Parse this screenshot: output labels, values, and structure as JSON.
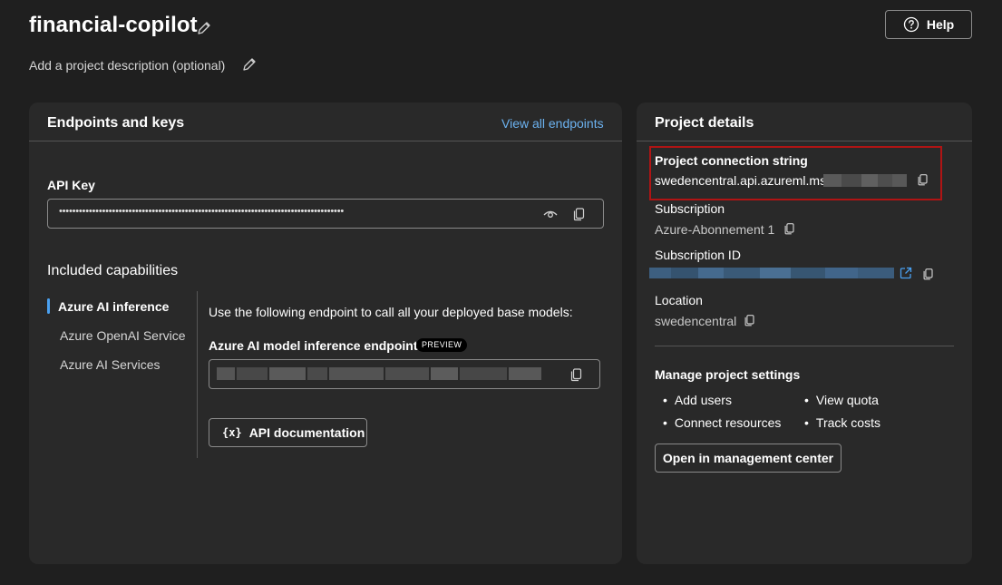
{
  "header": {
    "title": "financial-copilot",
    "description_placeholder": "Add a project description (optional)",
    "help_label": "Help"
  },
  "endpoints_card": {
    "title": "Endpoints and keys",
    "view_all_label": "View all endpoints",
    "api_key_label": "API Key",
    "api_key_value": "••••••••••••••••••••••••••••••••••••••••••••••••••••••••••••••••••••••••••••••••••••••",
    "capabilities_title": "Included capabilities",
    "capabilities": [
      {
        "label": "Azure AI inference",
        "selected": true
      },
      {
        "label": "Azure OpenAI Service",
        "selected": false
      },
      {
        "label": "Azure AI Services",
        "selected": false
      }
    ],
    "capability_description": "Use the following endpoint to call all your deployed base models:",
    "endpoint_label": "Azure AI model inference endpoint",
    "endpoint_badge": "PREVIEW",
    "api_doc_icon": "{x}",
    "api_doc_label": "API documentation"
  },
  "project_details": {
    "title": "Project details",
    "connection_string_label": "Project connection string",
    "connection_string_value": "swedencentral.api.azureml.ms;",
    "subscription_label": "Subscription",
    "subscription_value": "Azure-Abonnement 1",
    "subscription_id_label": "Subscription ID",
    "location_label": "Location",
    "location_value": "swedencentral",
    "manage_title": "Manage project settings",
    "manage_links": [
      "Add users",
      "View quota",
      "Connect resources",
      "Track costs"
    ],
    "open_management_label": "Open in management center"
  },
  "colors": {
    "background": "#1f1f1f",
    "card": "#292929",
    "link": "#6cb2f0",
    "selection_accent": "#4aa0f0",
    "highlight_box": "#b01414",
    "subscription_id_blur": "#3d5f80"
  },
  "icons": [
    "pencil-icon",
    "help-circle-icon",
    "eye-icon",
    "copy-icon",
    "external-link-icon",
    "variable-icon"
  ]
}
